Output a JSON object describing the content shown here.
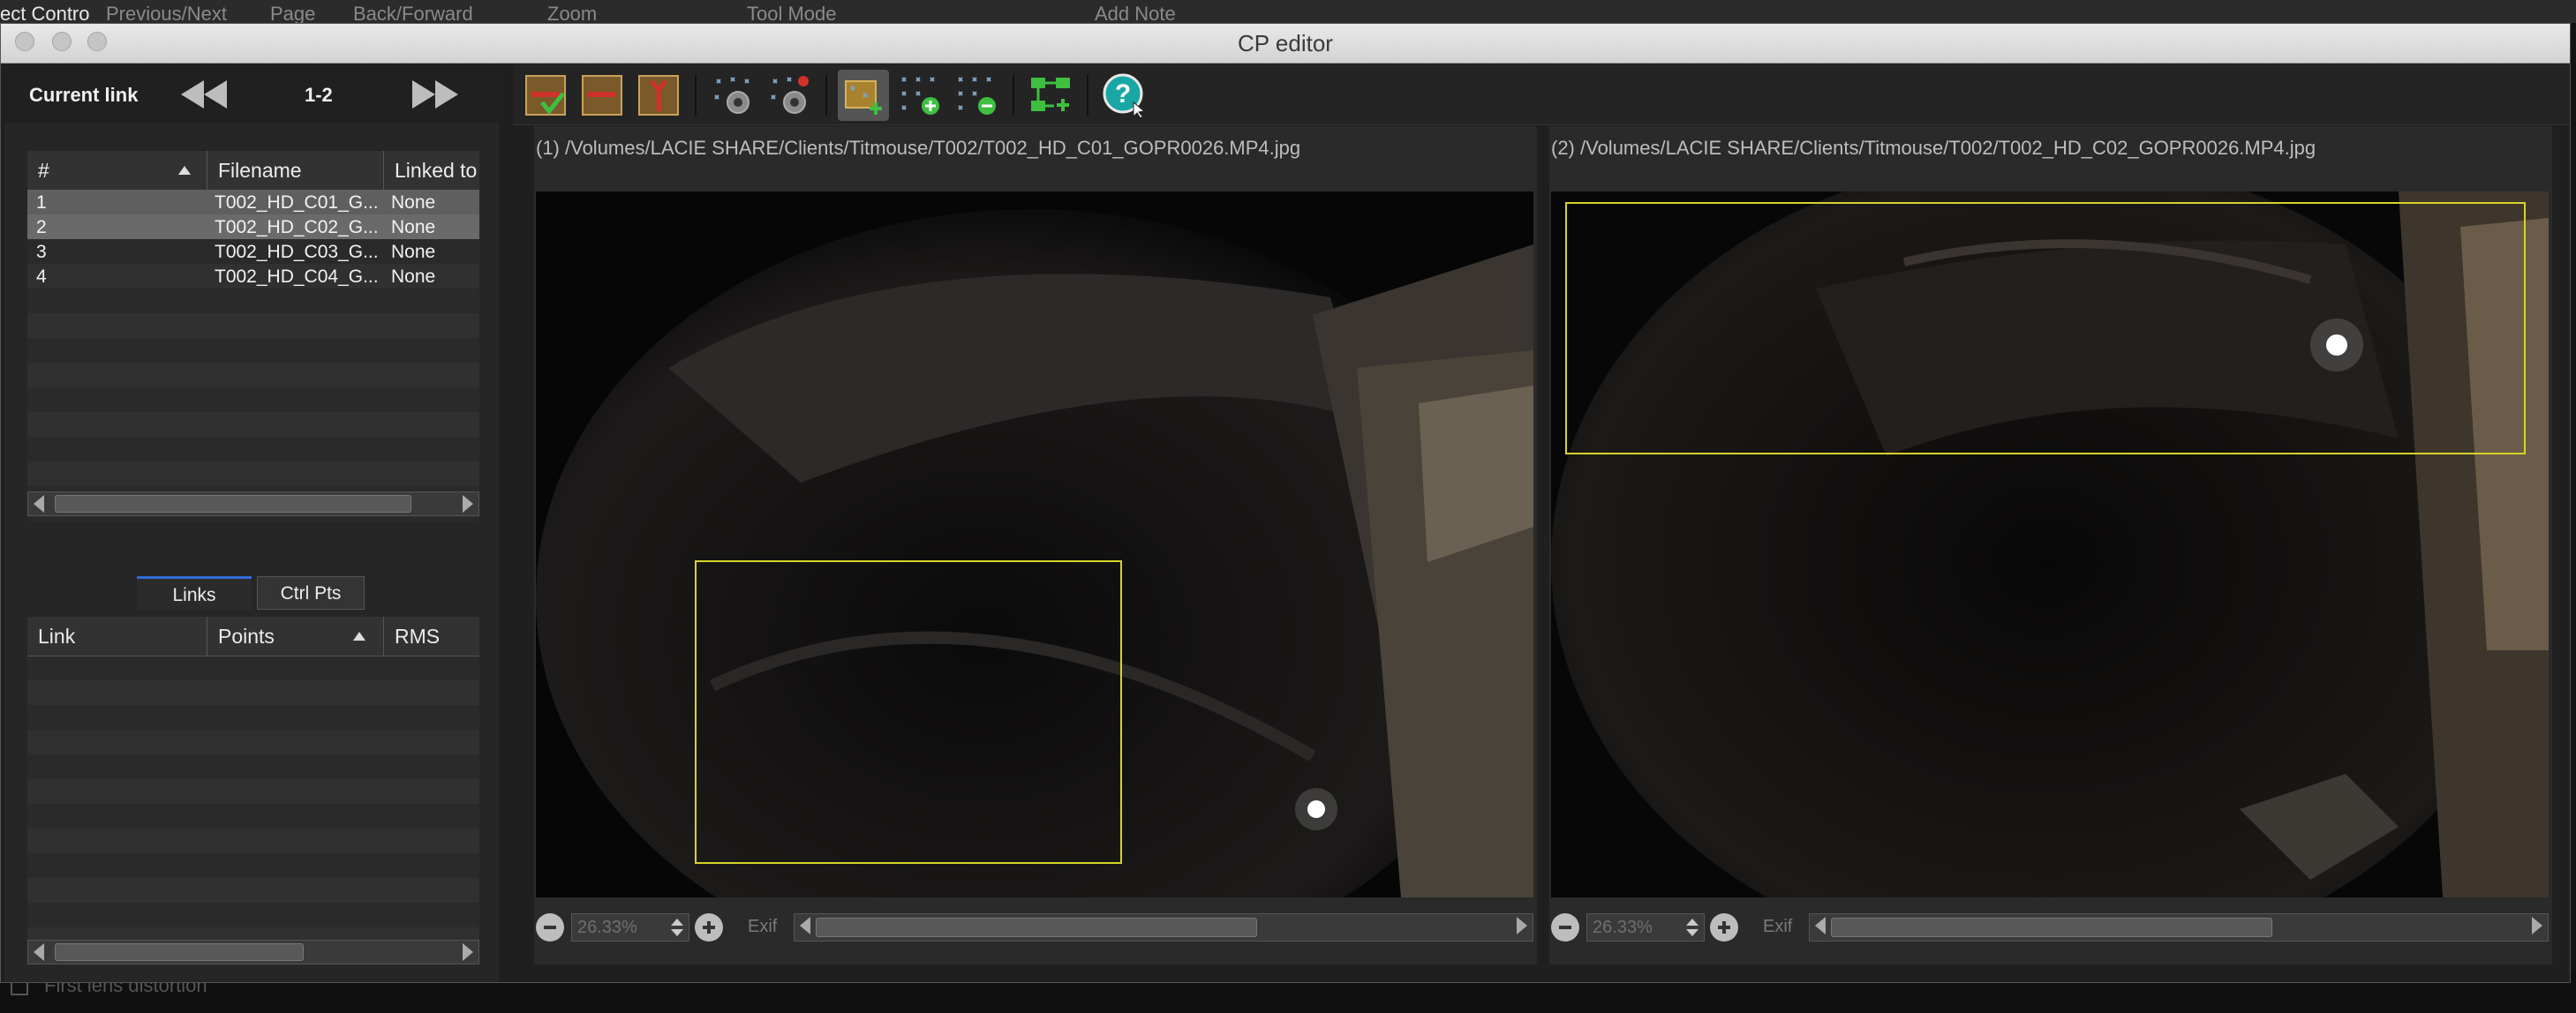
{
  "background_menu": [
    "ect Contro",
    "Previous/Next",
    "Page",
    "Back/Forward",
    "Zoom",
    "Tool Mode",
    "Add Note"
  ],
  "background_bottom_text": "First lens distortion",
  "window": {
    "title": "CP editor"
  },
  "nav": {
    "current_link_label": "Current link",
    "page_indicator": "1-2"
  },
  "images_table": {
    "columns": [
      "#",
      "Filename",
      "Linked to"
    ],
    "rows": [
      {
        "num": "1",
        "filename": "T002_HD_C01_G...",
        "linked": "None"
      },
      {
        "num": "2",
        "filename": "T002_HD_C02_G...",
        "linked": "None"
      },
      {
        "num": "3",
        "filename": "T002_HD_C03_G...",
        "linked": "None"
      },
      {
        "num": "4",
        "filename": "T002_HD_C04_G...",
        "linked": "None"
      }
    ]
  },
  "tabs": {
    "links": "Links",
    "ctrl_pts": "Ctrl Pts"
  },
  "links_table": {
    "columns": [
      "Link",
      "Points",
      "RMS"
    ]
  },
  "left_image": {
    "path": "(1) /Volumes/LACIE SHARE/Clients/Titmouse/T002/T002_HD_C01_GOPR0026.MP4.jpg",
    "zoom": "26.33%",
    "exif_label": "Exif"
  },
  "right_image": {
    "path": "(2) /Volumes/LACIE SHARE/Clients/Titmouse/T002/T002_HD_C02_GOPR0026.MP4.jpg",
    "zoom": "26.33%",
    "exif_label": "Exif"
  },
  "colors": {
    "selection_box": "#d8d22a",
    "toolbar_green": "#3fbf3f",
    "help_teal": "#19a7a5"
  }
}
